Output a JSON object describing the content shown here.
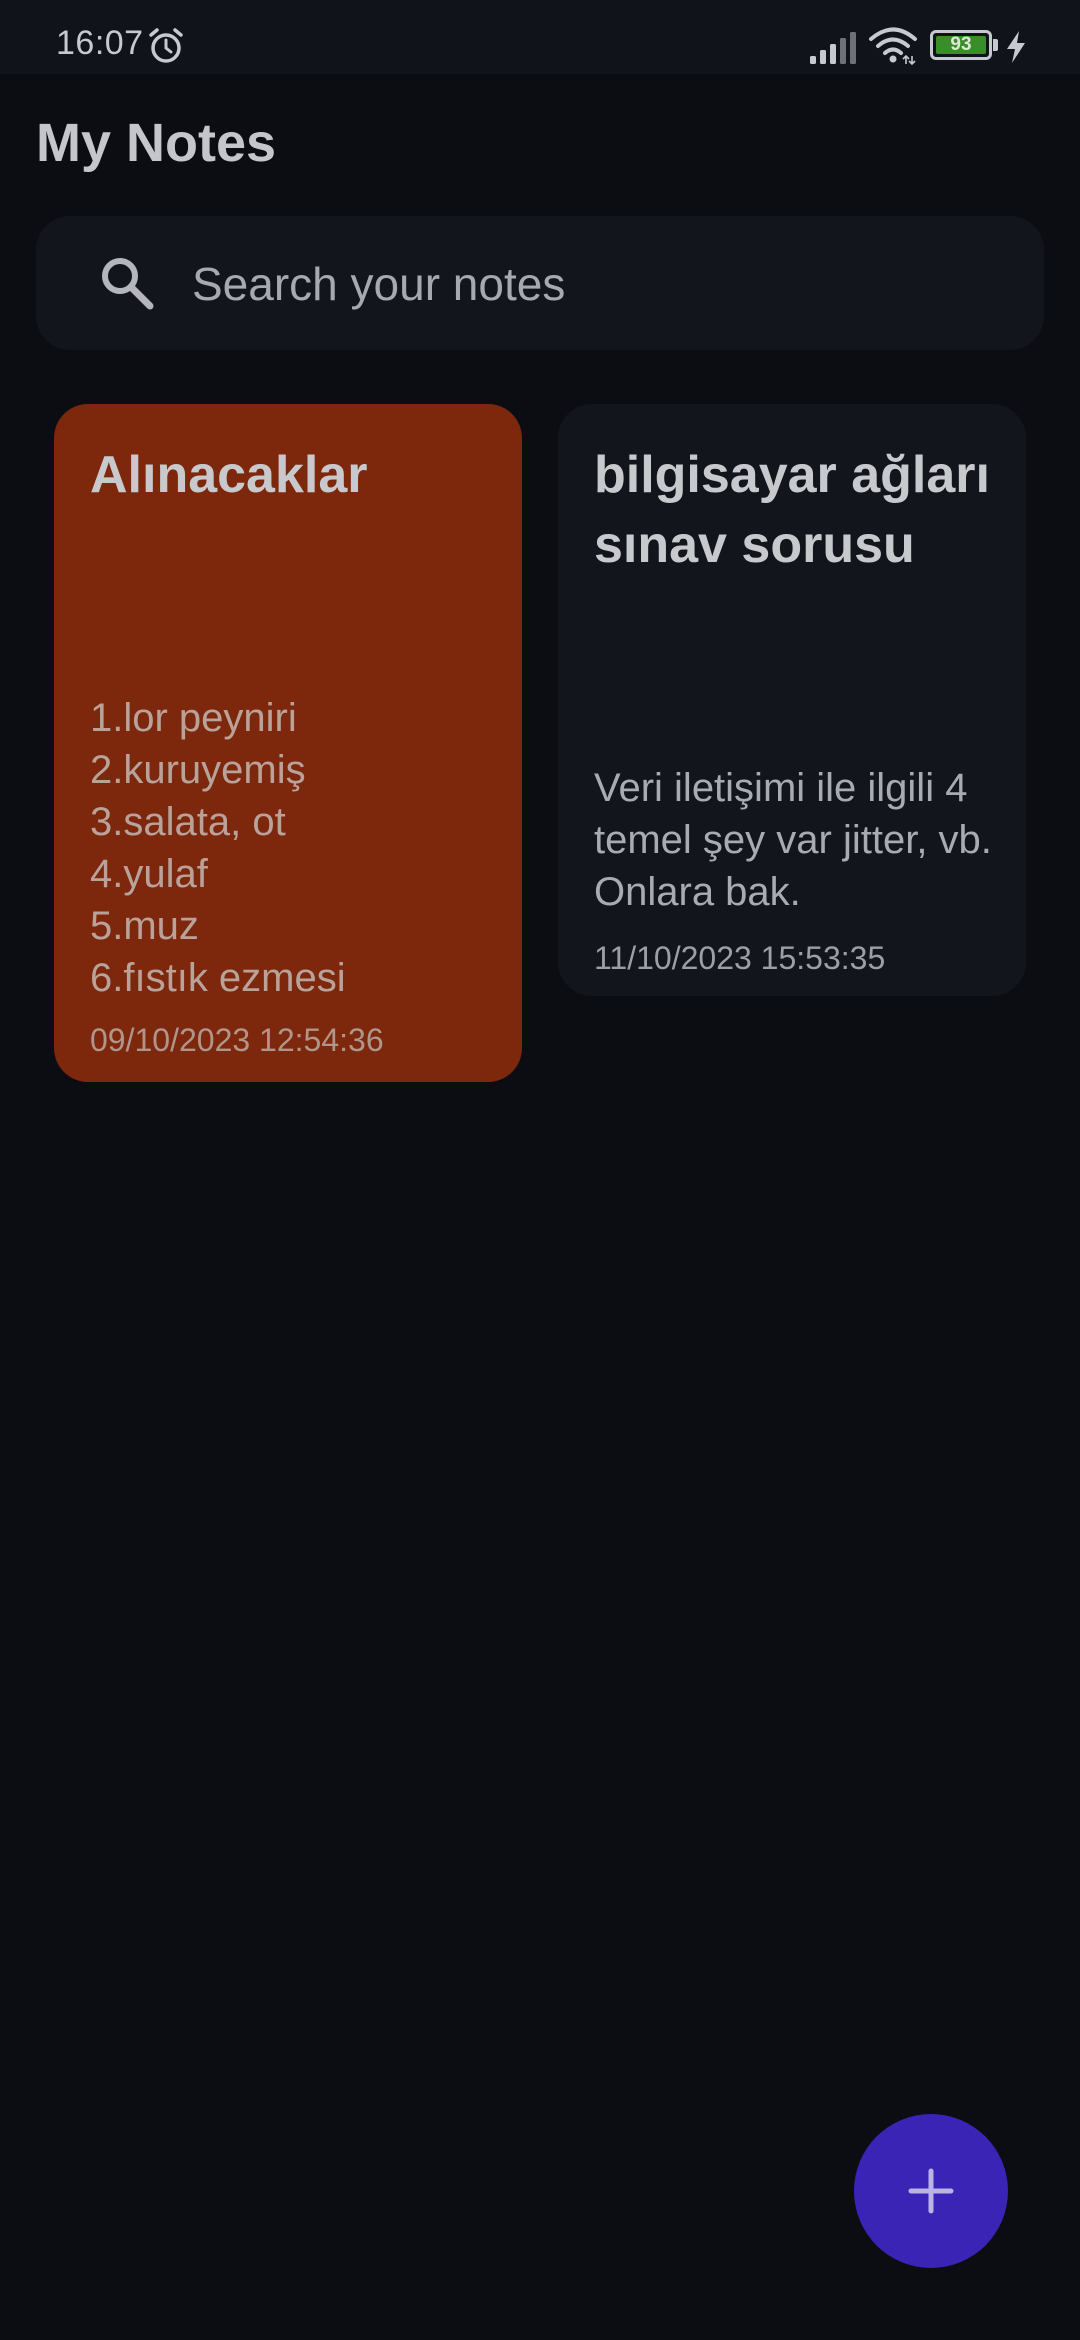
{
  "status_bar": {
    "time": "16:07",
    "battery_level": "93",
    "icons": [
      "alarm-icon",
      "signal-icon",
      "wifi-icon",
      "battery-icon",
      "charging-bolt-icon"
    ]
  },
  "header": {
    "title": "My Notes"
  },
  "search": {
    "placeholder": "Search your notes",
    "value": "",
    "icon": "search-icon"
  },
  "notes": [
    {
      "title": "Alınacaklar",
      "body": "1.lor peyniri\n2.kuruyemiş\n3.salata, ot\n4.yulaf\n5.muz\n6.fıstık ezmesi",
      "date": "09/10/2023 12:54:36",
      "color": "#7d280d"
    },
    {
      "title": "bilgisayar ağları sınav sorusu",
      "body": "Veri iletişimi ile ilgili 4 temel şey var jitter, vb. Onlara bak.",
      "date": "11/10/2023 15:53:35",
      "color": "#12151c"
    }
  ],
  "fab": {
    "icon": "plus-icon",
    "color": "#3a24b6"
  }
}
